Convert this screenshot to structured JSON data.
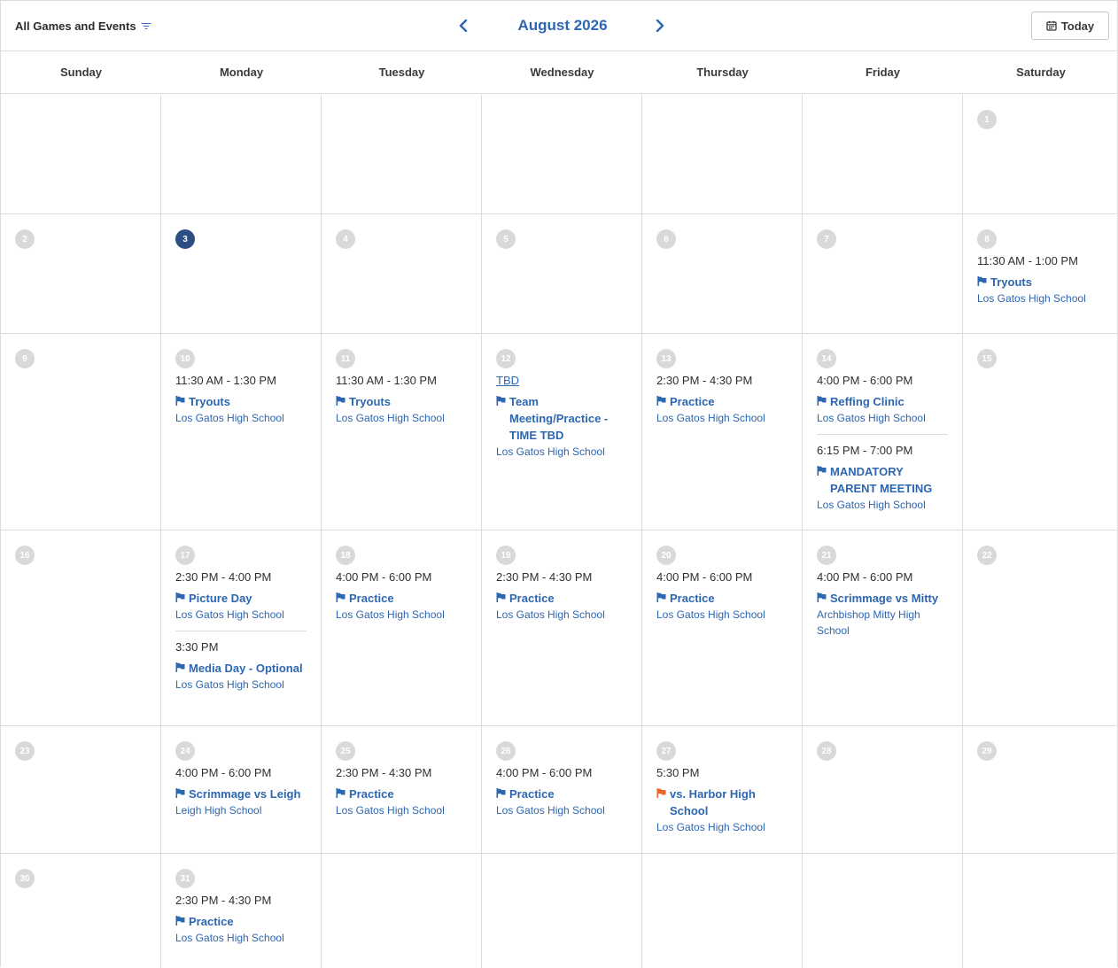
{
  "header": {
    "filter_label": "All Games and Events",
    "month_title": "August 2026",
    "today_label": "Today"
  },
  "weekdays": [
    "Sunday",
    "Monday",
    "Tuesday",
    "Wednesday",
    "Thursday",
    "Friday",
    "Saturday"
  ],
  "colors": {
    "accent": "#2d66b1",
    "today_badge": "#2c4f83",
    "day_badge": "#d9d9d9",
    "flag_default": "#2d66b1",
    "flag_game": "#e8672a"
  },
  "weeks": [
    [
      {
        "day": null
      },
      {
        "day": null
      },
      {
        "day": null
      },
      {
        "day": null
      },
      {
        "day": null
      },
      {
        "day": null
      },
      {
        "day": "1",
        "events": []
      }
    ],
    [
      {
        "day": "2",
        "events": []
      },
      {
        "day": "3",
        "today": true,
        "events": []
      },
      {
        "day": "4",
        "events": []
      },
      {
        "day": "5",
        "events": []
      },
      {
        "day": "6",
        "events": []
      },
      {
        "day": "7",
        "events": []
      },
      {
        "day": "8",
        "events": [
          {
            "time": "11:30 AM - 1:00 PM",
            "title": "Tryouts",
            "location": "Los Gatos High School",
            "flag": "default"
          }
        ]
      }
    ],
    [
      {
        "day": "9",
        "events": []
      },
      {
        "day": "10",
        "events": [
          {
            "time": "11:30 AM - 1:30 PM",
            "title": "Tryouts",
            "location": "Los Gatos High School",
            "flag": "default"
          }
        ]
      },
      {
        "day": "11",
        "events": [
          {
            "time": "11:30 AM - 1:30 PM",
            "title": "Tryouts",
            "location": "Los Gatos High School",
            "flag": "default"
          }
        ]
      },
      {
        "day": "12",
        "events": [
          {
            "time": "TBD",
            "tbd": true,
            "title": "Team Meeting/Practice - TIME TBD",
            "location": "Los Gatos High School",
            "flag": "default"
          }
        ]
      },
      {
        "day": "13",
        "events": [
          {
            "time": "2:30 PM - 4:30 PM",
            "title": "Practice",
            "location": "Los Gatos High School",
            "flag": "default"
          }
        ]
      },
      {
        "day": "14",
        "events": [
          {
            "time": "4:00 PM - 6:00 PM",
            "title": "Reffing Clinic",
            "location": "Los Gatos High School",
            "flag": "default"
          },
          {
            "time": "6:15 PM - 7:00 PM",
            "title": "MANDATORY PARENT MEETING",
            "location": "Los Gatos High School",
            "flag": "default"
          }
        ]
      },
      {
        "day": "15",
        "events": []
      }
    ],
    [
      {
        "day": "16",
        "events": []
      },
      {
        "day": "17",
        "events": [
          {
            "time": "2:30 PM - 4:00 PM",
            "title": "Picture Day",
            "location": "Los Gatos High School",
            "flag": "default"
          },
          {
            "time": "3:30 PM",
            "title": "Media Day - Optional",
            "location": "Los Gatos High School",
            "flag": "default"
          }
        ]
      },
      {
        "day": "18",
        "events": [
          {
            "time": "4:00 PM - 6:00 PM",
            "title": "Practice",
            "location": "Los Gatos High School",
            "flag": "default"
          }
        ]
      },
      {
        "day": "19",
        "events": [
          {
            "time": "2:30 PM - 4:30 PM",
            "title": "Practice",
            "location": "Los Gatos High School",
            "flag": "default"
          }
        ]
      },
      {
        "day": "20",
        "events": [
          {
            "time": "4:00 PM - 6:00 PM",
            "title": "Practice",
            "location": "Los Gatos High School",
            "flag": "default"
          }
        ]
      },
      {
        "day": "21",
        "events": [
          {
            "time": "4:00 PM - 6:00 PM",
            "title": "Scrimmage vs Mitty",
            "location": "Archbishop Mitty High School",
            "flag": "default"
          }
        ]
      },
      {
        "day": "22",
        "events": []
      }
    ],
    [
      {
        "day": "23",
        "events": []
      },
      {
        "day": "24",
        "events": [
          {
            "time": "4:00 PM - 6:00 PM",
            "title": "Scrimmage vs Leigh",
            "location": "Leigh High School",
            "flag": "default"
          }
        ]
      },
      {
        "day": "25",
        "events": [
          {
            "time": "2:30 PM - 4:30 PM",
            "title": "Practice",
            "location": "Los Gatos High School",
            "flag": "default"
          }
        ]
      },
      {
        "day": "26",
        "events": [
          {
            "time": "4:00 PM - 6:00 PM",
            "title": "Practice",
            "location": "Los Gatos High School",
            "flag": "default"
          }
        ]
      },
      {
        "day": "27",
        "events": [
          {
            "time": "5:30 PM",
            "title": "vs. Harbor High School",
            "location": "Los Gatos High School",
            "flag": "game"
          }
        ]
      },
      {
        "day": "28",
        "events": []
      },
      {
        "day": "29",
        "events": []
      }
    ],
    [
      {
        "day": "30",
        "events": []
      },
      {
        "day": "31",
        "events": [
          {
            "time": "2:30 PM - 4:30 PM",
            "title": "Practice",
            "location": "Los Gatos High School",
            "flag": "default"
          }
        ]
      },
      {
        "day": null
      },
      {
        "day": null
      },
      {
        "day": null
      },
      {
        "day": null
      },
      {
        "day": null
      }
    ]
  ]
}
